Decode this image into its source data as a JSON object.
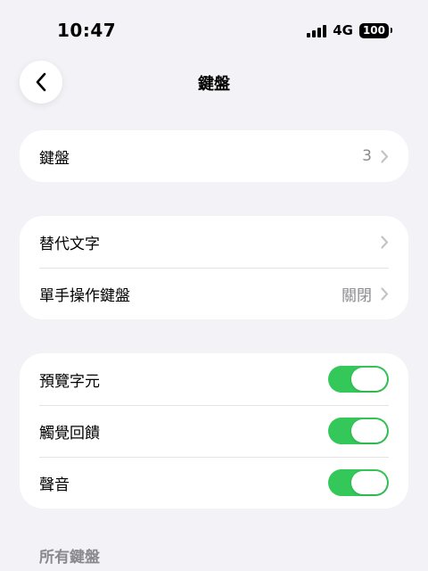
{
  "status_bar": {
    "time": "10:47",
    "network": "4G",
    "battery": "100"
  },
  "nav": {
    "title": "鍵盤",
    "back_icon": "chevron-left-icon"
  },
  "groups": {
    "keyboards": {
      "label": "鍵盤",
      "value": "3"
    },
    "text": {
      "replacement_label": "替代文字",
      "one_handed_label": "單手操作鍵盤",
      "one_handed_value": "關閉"
    },
    "feedback": {
      "preview_label": "預覽字元",
      "preview_on": true,
      "haptic_label": "觸覺回饋",
      "haptic_on": true,
      "sound_label": "聲音",
      "sound_on": true
    }
  },
  "section": {
    "all_keyboards": "所有鍵盤"
  },
  "colors": {
    "toggle_on": "#34c759",
    "background": "#f2f2f7",
    "secondary_text": "#8a8a8e"
  }
}
